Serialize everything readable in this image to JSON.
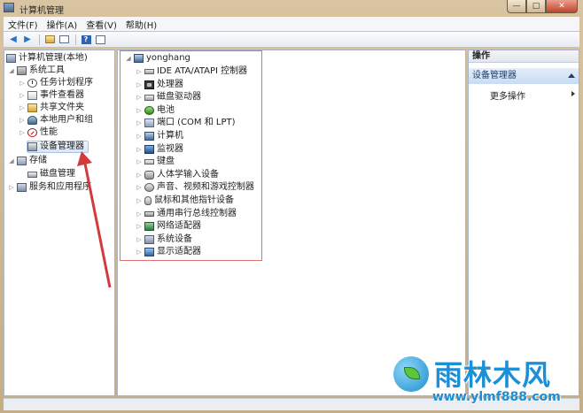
{
  "window": {
    "title": "计算机管理",
    "buttons": {
      "minimize": "—",
      "maximize": "□",
      "close": "✕"
    }
  },
  "menu": [
    "文件(F)",
    "操作(A)",
    "查看(V)",
    "帮助(H)"
  ],
  "toolbar": [
    "back-icon",
    "forward-icon",
    "up-icon",
    "show-tree-icon",
    "help-icon",
    "properties-icon"
  ],
  "left_tree": {
    "root": "计算机管理(本地)",
    "system_tools": "系统工具",
    "task_scheduler": "任务计划程序",
    "event_viewer": "事件查看器",
    "shared_folders": "共享文件夹",
    "local_users": "本地用户和组",
    "performance": "性能",
    "device_manager": "设备管理器",
    "storage": "存储",
    "disk_management": "磁盘管理",
    "services_apps": "服务和应用程序"
  },
  "device_tree": {
    "computer": "yonghang",
    "items": [
      {
        "label": "IDE ATA/ATAPI 控制器",
        "icon": "ide-controller-icon"
      },
      {
        "label": "处理器",
        "icon": "processor-icon"
      },
      {
        "label": "磁盘驱动器",
        "icon": "disk-drive-icon"
      },
      {
        "label": "电池",
        "icon": "battery-icon"
      },
      {
        "label": "端口 (COM 和 LPT)",
        "icon": "port-icon"
      },
      {
        "label": "计算机",
        "icon": "computer-icon"
      },
      {
        "label": "监视器",
        "icon": "monitor-icon"
      },
      {
        "label": "键盘",
        "icon": "keyboard-icon"
      },
      {
        "label": "人体学输入设备",
        "icon": "hid-icon"
      },
      {
        "label": "声音、视频和游戏控制器",
        "icon": "sound-icon"
      },
      {
        "label": "鼠标和其他指针设备",
        "icon": "mouse-icon"
      },
      {
        "label": "通用串行总线控制器",
        "icon": "usb-icon"
      },
      {
        "label": "网络适配器",
        "icon": "network-adapter-icon"
      },
      {
        "label": "系统设备",
        "icon": "system-device-icon"
      },
      {
        "label": "显示适配器",
        "icon": "display-adapter-icon"
      }
    ]
  },
  "actions": {
    "header": "操作",
    "section": "设备管理器",
    "more": "更多操作"
  },
  "watermark": {
    "name": "雨林木风",
    "url": "www.ylmf888.com"
  },
  "colors": {
    "highlight_box": "#e07070",
    "annotation_arrow": "#d23b3b",
    "watermark": "#1d8fd6"
  }
}
